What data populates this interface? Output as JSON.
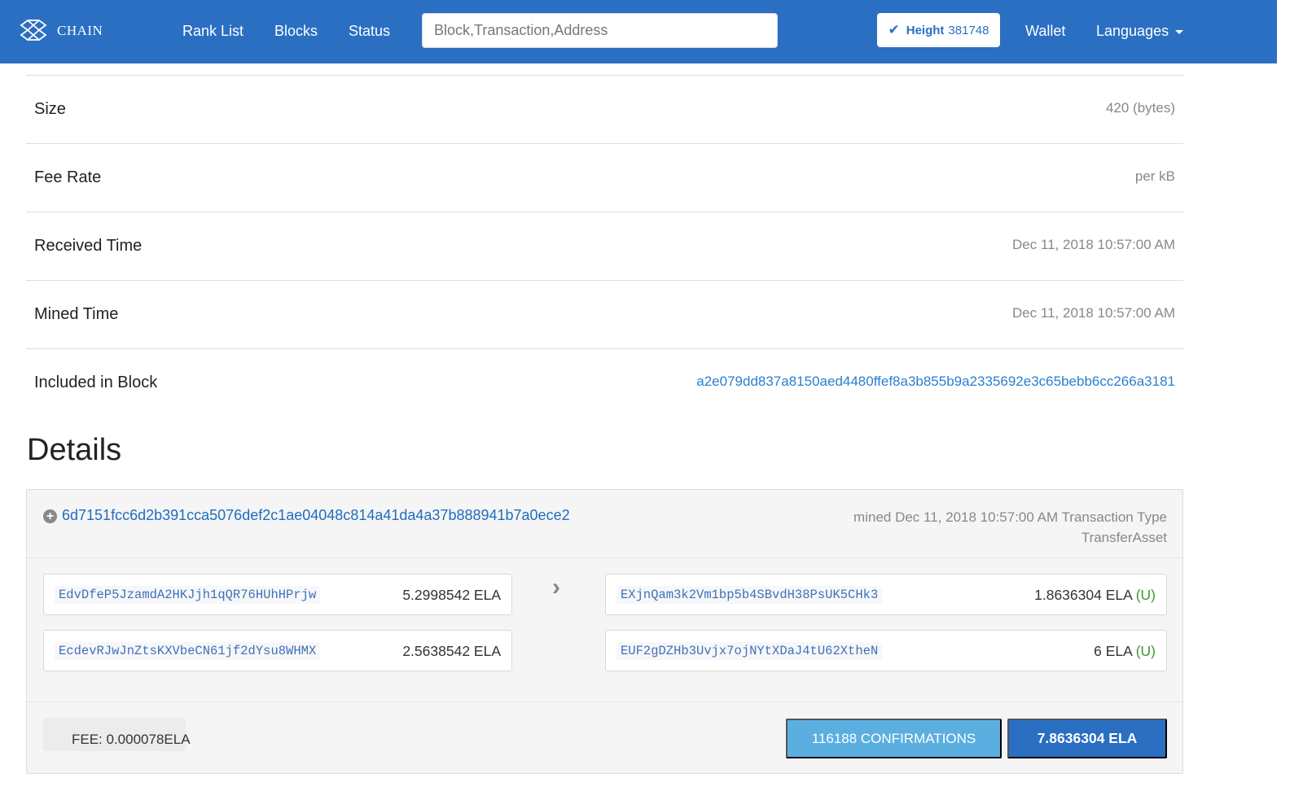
{
  "navbar": {
    "brand": "CHAIN",
    "links": [
      "Rank List",
      "Blocks",
      "Status"
    ],
    "search_placeholder": "Block,Transaction,Address",
    "height_label": "Height",
    "height_value": "381748",
    "wallet": "Wallet",
    "languages": "Languages"
  },
  "info": {
    "size_label": "Size",
    "size_value": "420 (bytes)",
    "fee_rate_label": "Fee Rate",
    "fee_rate_value": "per kB",
    "received_label": "Received Time",
    "received_value": "Dec 11, 2018 10:57:00 AM",
    "mined_label": "Mined Time",
    "mined_value": "Dec 11, 2018 10:57:00 AM",
    "block_label": "Included in Block",
    "block_value": "a2e079dd837a8150aed4480ffef8a3b855b9a2335692e3c65bebb6cc266a3181"
  },
  "details": {
    "title": "Details",
    "txid": "6d7151fcc6d2b391cca5076def2c1ae04048c814a41da4a37b888941b7a0ece2",
    "meta": "mined Dec 11, 2018 10:57:00 AM Transaction Type TransferAsset",
    "inputs": [
      {
        "address": "EdvDfeP5JzamdA2HKJjh1qQR76HUhHPrjw",
        "amount": "5.2998542 ELA"
      },
      {
        "address": "EcdevRJwJnZtsKXVbeCN61jf2dYsu8WHMX",
        "amount": "2.5638542 ELA"
      }
    ],
    "outputs": [
      {
        "address": "EXjnQam3k2Vm1bp5b4SBvdH38PsUK5CHk3",
        "amount": "1.8636304 ELA",
        "flag": "(U)"
      },
      {
        "address": "EUF2gDZHb3Uvjx7ojNYtXDaJ4tU62XtheN",
        "amount": "6 ELA",
        "flag": "(U)"
      }
    ],
    "fee": "FEE: 0.000078ELA",
    "confirmations": "116188 CONFIRMATIONS",
    "total": "7.8636304 ELA"
  },
  "colors": {
    "brand": "#2a6fc2",
    "link": "#2a7fcf",
    "confirm": "#5bafe0",
    "unspent": "#3c9a2e"
  },
  "icons": [
    "chain-logo-icon",
    "check-icon",
    "caret-down-icon",
    "plus-circle-icon",
    "chevron-right-icon"
  ]
}
